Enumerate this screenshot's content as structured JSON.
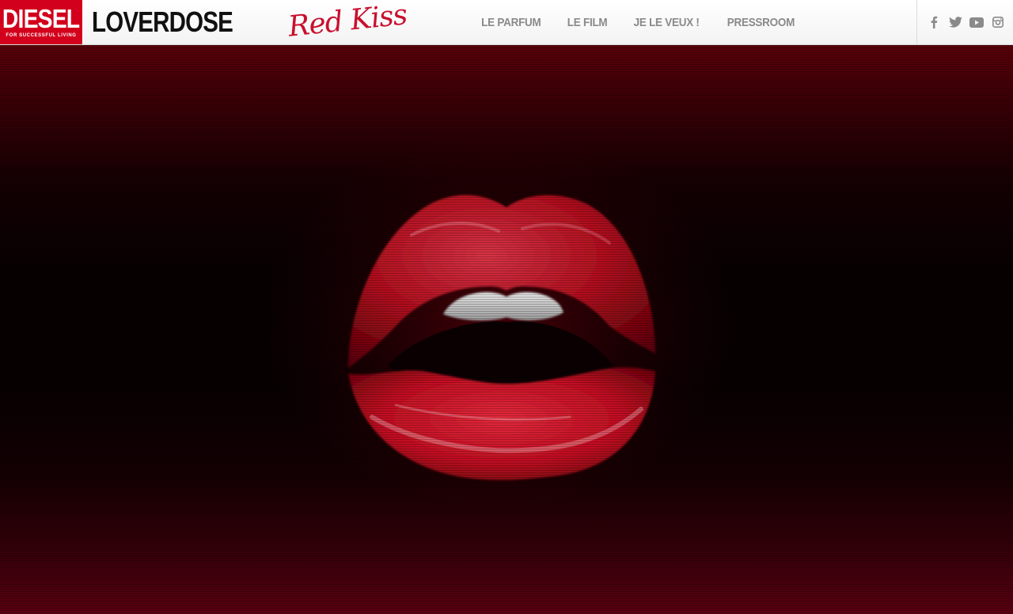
{
  "header": {
    "diesel_logo": {
      "word": "DIESEL",
      "tagline": "FOR SUCCESSFUL LIVING"
    },
    "brand": {
      "name": "LOVERDOSE",
      "script": "Red Kiss"
    },
    "nav": [
      {
        "label": "LE PARFUM"
      },
      {
        "label": "LE FILM"
      },
      {
        "label": "JE LE VEUX !"
      },
      {
        "label": "PRESSROOM"
      }
    ],
    "social": [
      "facebook-icon",
      "twitter-icon",
      "youtube-icon",
      "instagram-icon"
    ]
  },
  "hero": {
    "image": "red-lips",
    "colors": {
      "lip": "#c4101f",
      "background": "#1a0003",
      "accent": "#d2001c"
    }
  }
}
